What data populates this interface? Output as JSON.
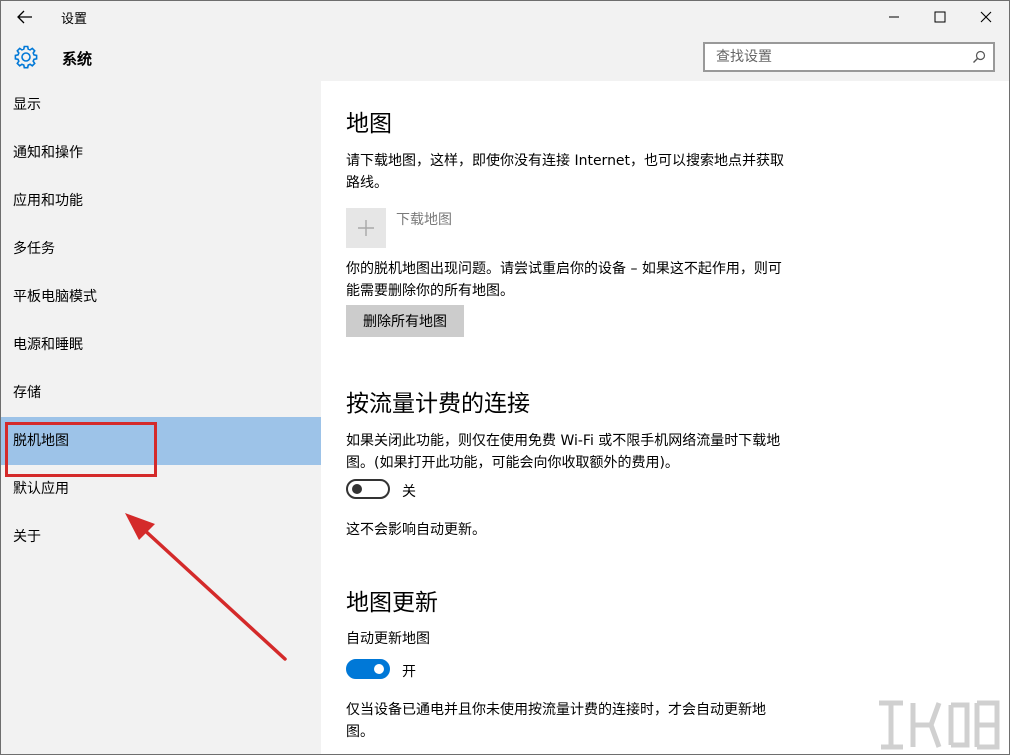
{
  "window": {
    "title": "设置"
  },
  "header": {
    "section_title": "系统"
  },
  "search": {
    "placeholder": "查找设置"
  },
  "sidebar": {
    "items": [
      {
        "label": "显示"
      },
      {
        "label": "通知和操作"
      },
      {
        "label": "应用和功能"
      },
      {
        "label": "多任务"
      },
      {
        "label": "平板电脑模式"
      },
      {
        "label": "电源和睡眠"
      },
      {
        "label": "存储"
      },
      {
        "label": "脱机地图",
        "selected": true
      },
      {
        "label": "默认应用"
      },
      {
        "label": "关于"
      }
    ]
  },
  "maps": {
    "heading": "地图",
    "description": "请下载地图，这样，即使你没有连接 Internet，也可以搜索地点并获取路线。",
    "download_label": "下载地图",
    "problem_text": "你的脱机地图出现问题。请尝试重启你的设备 – 如果这不起作用，则可能需要删除你的所有地图。",
    "delete_button": "删除所有地图"
  },
  "metered": {
    "heading": "按流量计费的连接",
    "description": "如果关闭此功能，则仅在使用免费 Wi-Fi 或不限手机网络流量时下载地图。(如果打开此功能，可能会向你收取额外的费用)。",
    "toggle_state": "关",
    "toggle_on": false,
    "note": "这不会影响自动更新。"
  },
  "updates": {
    "heading": "地图更新",
    "auto_label": "自动更新地图",
    "toggle_state": "开",
    "toggle_on": true,
    "note": "仅当设备已通电并且你未使用按流量计费的连接时，才会自动更新地图。"
  },
  "colors": {
    "sidebar_bg": "#f2f2f2",
    "selected_bg": "#9dc3e8",
    "accent": "#0078d7",
    "annotation": "#d42a2a"
  }
}
